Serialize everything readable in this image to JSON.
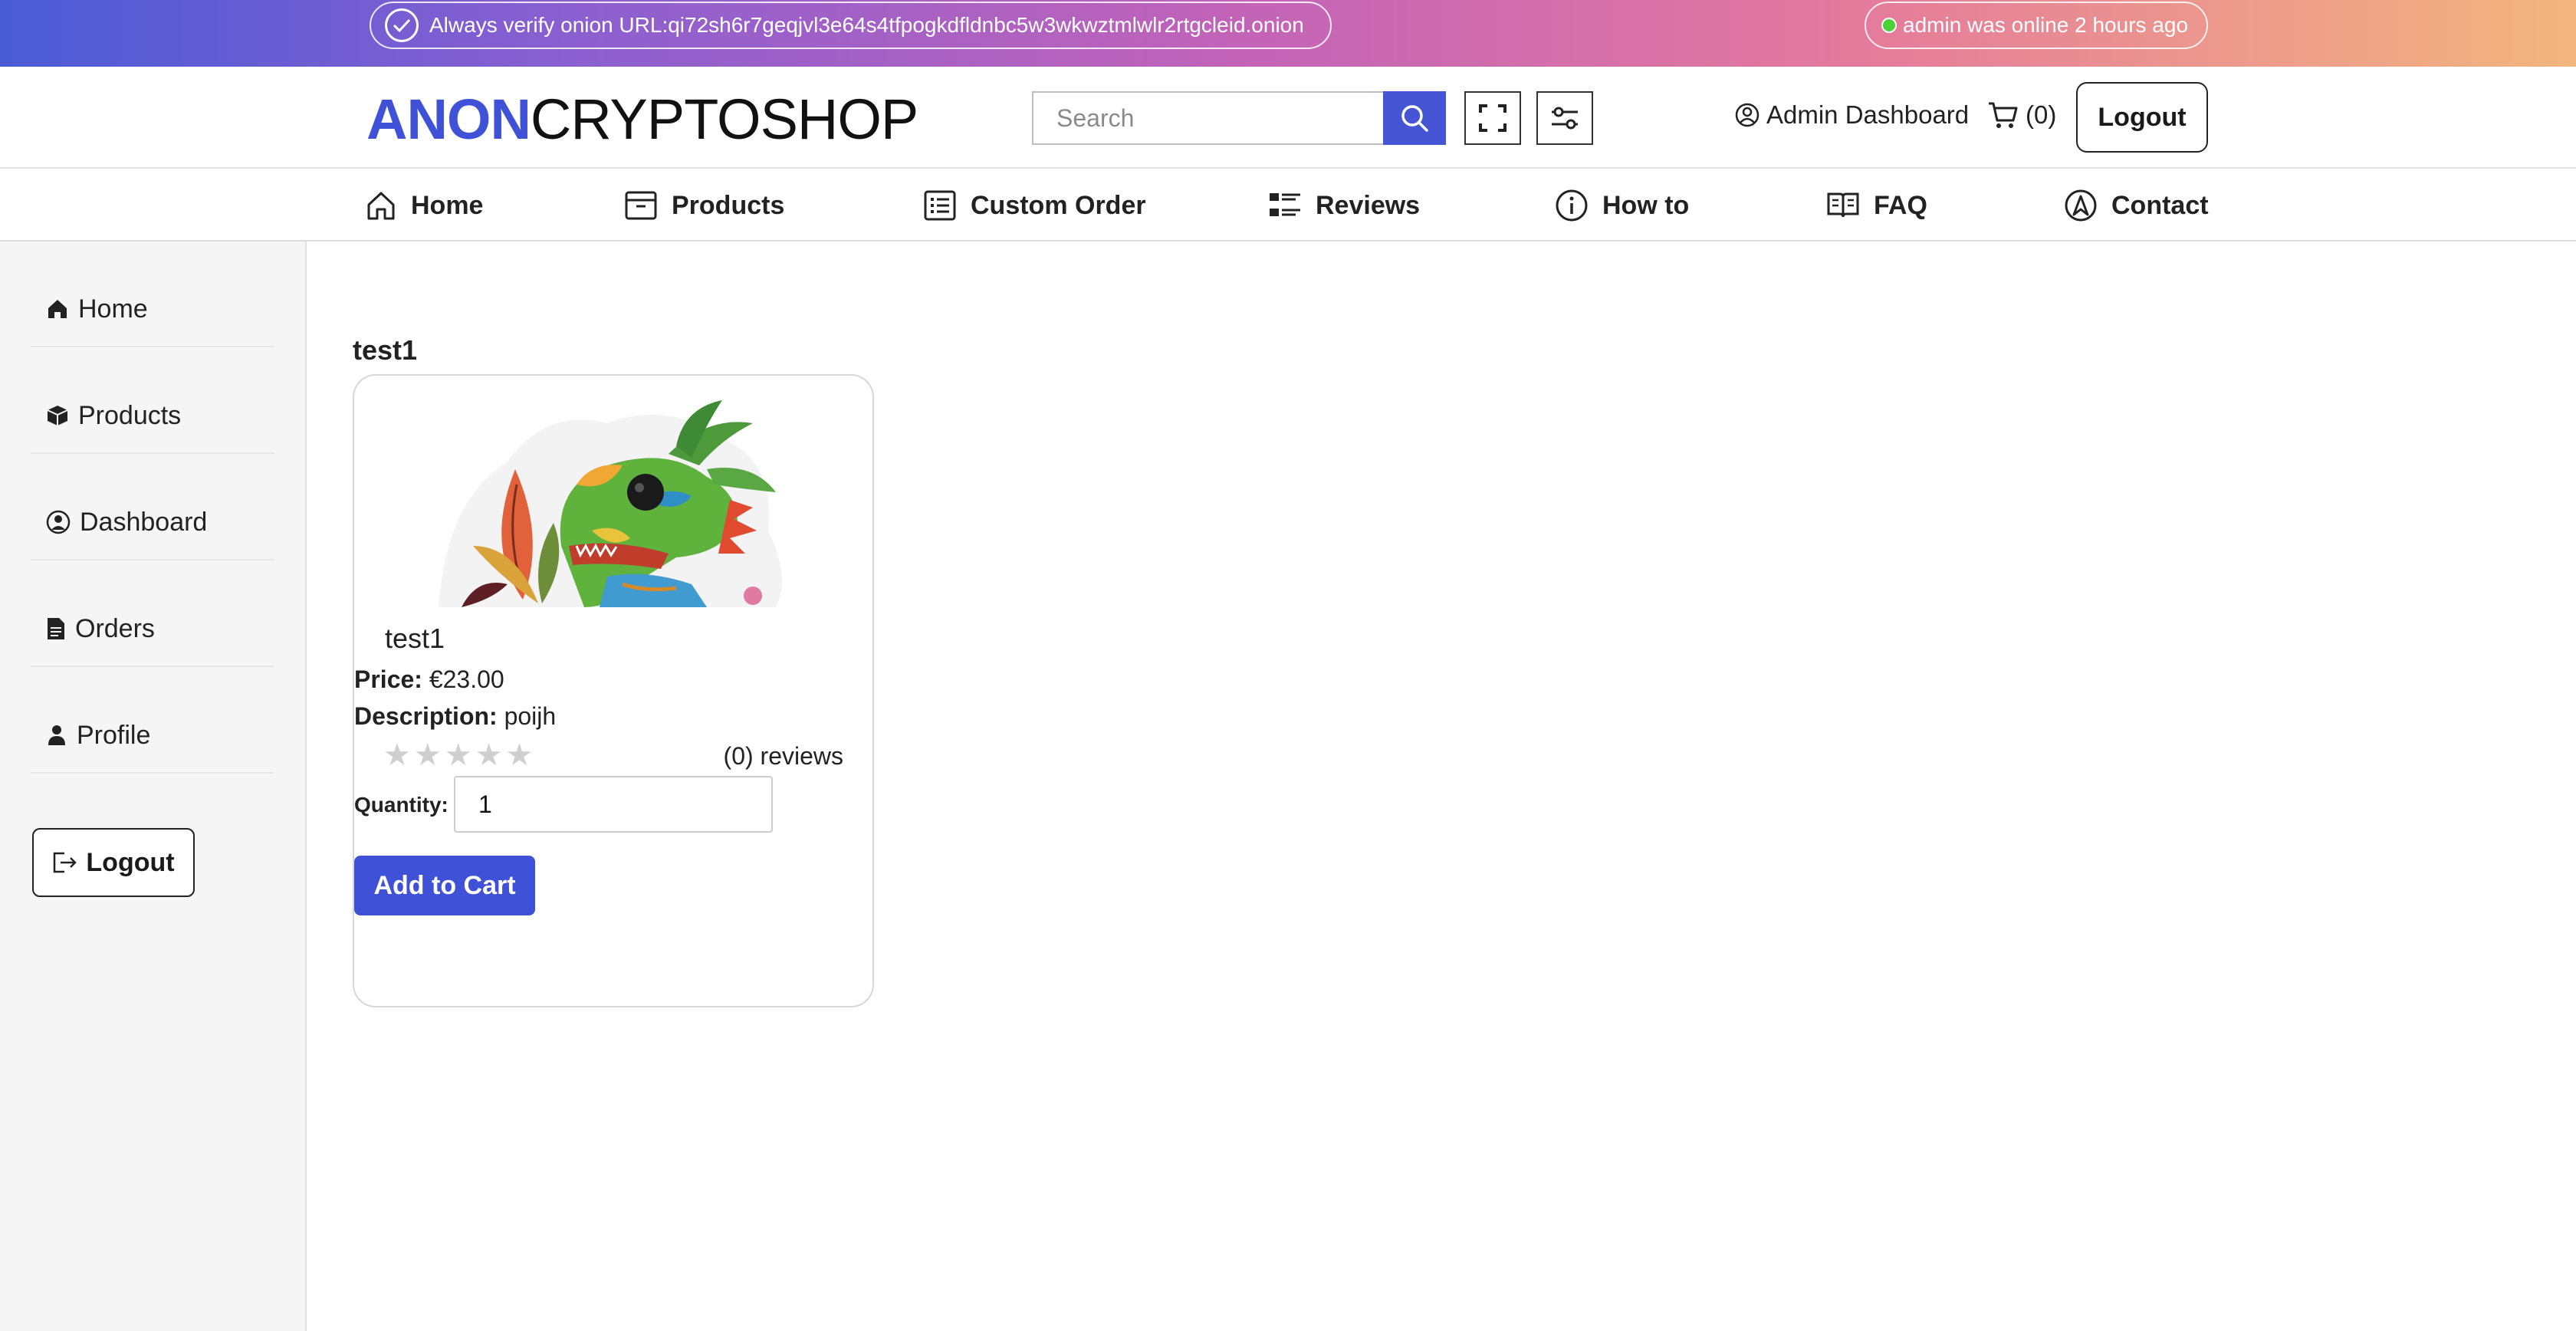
{
  "banner": {
    "onion_notice": "Always verify onion URL:qi72sh6r7geqjvl3e64s4tfpogkdfldnbc5w3wkwztmlwlr2rtgcleid.onion",
    "online_status": "admin was online 2 hours ago",
    "colors": {
      "gradient_start": "#4a5bd6",
      "gradient_end": "#f3b67e",
      "online_dot": "#4cd137"
    }
  },
  "header": {
    "logo_part1": "ANON",
    "logo_part2": "CRYPTOSHOP",
    "search_placeholder": "Search",
    "admin_dashboard_label": "Admin Dashboard",
    "cart_label": "(0)",
    "logout_label": "Logout",
    "colors": {
      "brand": "#3f51d6",
      "search_button": "#4655d3"
    }
  },
  "nav": {
    "items": [
      {
        "label": "Home",
        "icon": "home-icon"
      },
      {
        "label": "Products",
        "icon": "box-icon"
      },
      {
        "label": "Custom Order",
        "icon": "list-icon"
      },
      {
        "label": "Reviews",
        "icon": "reviews-icon"
      },
      {
        "label": "How to",
        "icon": "info-icon"
      },
      {
        "label": "FAQ",
        "icon": "book-icon"
      },
      {
        "label": "Contact",
        "icon": "contact-icon"
      }
    ]
  },
  "sidebar": {
    "items": [
      {
        "label": "Home",
        "icon": "home-icon"
      },
      {
        "label": "Products",
        "icon": "cube-icon"
      },
      {
        "label": "Dashboard",
        "icon": "user-circle-icon"
      },
      {
        "label": "Orders",
        "icon": "document-icon"
      },
      {
        "label": "Profile",
        "icon": "person-icon"
      }
    ],
    "logout_label": "Logout"
  },
  "main": {
    "section_title": "test1",
    "product": {
      "name": "test1",
      "price_label": "Price:",
      "price": "€23.00",
      "description_label": "Description:",
      "description": "poijh",
      "rating_stars": "★★★★★",
      "rating": 0,
      "reviews_text": "(0) reviews",
      "quantity_label": "Quantity:",
      "quantity_value": "1",
      "add_to_cart_label": "Add to Cart"
    }
  }
}
